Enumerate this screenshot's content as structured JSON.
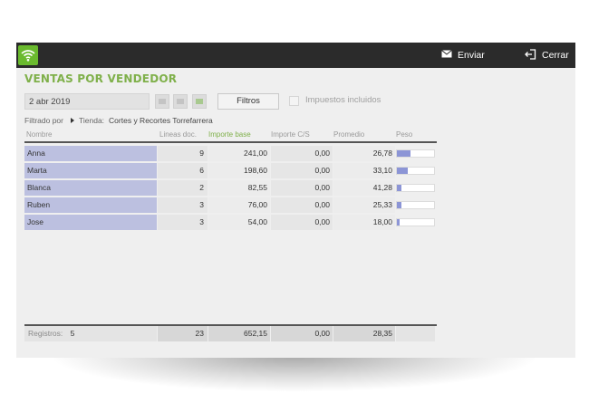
{
  "topbar": {
    "logo_icon": "wifi-icon",
    "enviar_label": "Enviar",
    "enviar_icon": "envelope-icon",
    "cerrar_label": "Cerrar",
    "cerrar_icon": "exit-icon"
  },
  "page": {
    "title": "VENTAS POR VENDEDOR"
  },
  "toolbar": {
    "date_value": "2 abr 2019",
    "view_buttons": [
      "table-view-icon",
      "list-view-icon",
      "grid-view-icon"
    ],
    "filtros_label": "Filtros",
    "impuestos_label": "Impuestos incluidos",
    "impuestos_checked": false
  },
  "filter": {
    "prefix": "Filtrado por",
    "key": "Tienda:",
    "value": "Cortes y Recortes Torrefarrera"
  },
  "table": {
    "headers": [
      "Nombre",
      "Lineas doc.",
      "Importe base",
      "Importe C/S",
      "Promedio",
      "Peso"
    ],
    "rows": [
      {
        "name": "Anna",
        "lineas": "9",
        "importe_base": "241,00",
        "importe_cs": "0,00",
        "promedio": "26,78",
        "peso": 0.37
      },
      {
        "name": "Marta",
        "lineas": "6",
        "importe_base": "198,60",
        "importe_cs": "0,00",
        "promedio": "33,10",
        "peso": 0.3
      },
      {
        "name": "Blanca",
        "lineas": "2",
        "importe_base": "82,55",
        "importe_cs": "0,00",
        "promedio": "41,28",
        "peso": 0.13
      },
      {
        "name": "Ruben",
        "lineas": "3",
        "importe_base": "76,00",
        "importe_cs": "0,00",
        "promedio": "25,33",
        "peso": 0.12
      },
      {
        "name": "Jose",
        "lineas": "3",
        "importe_base": "54,00",
        "importe_cs": "0,00",
        "promedio": "18,00",
        "peso": 0.08
      }
    ],
    "footer": {
      "registros_label": "Registros:",
      "registros_value": "5",
      "lineas": "23",
      "importe_base": "652,15",
      "importe_cs": "0,00",
      "promedio": "28,35"
    }
  },
  "colors": {
    "accent_green": "#7fb04a",
    "topbar_bg": "#2b2b2b",
    "name_cell": "#bcc0e0",
    "peso_bar": "#8c95d6"
  }
}
